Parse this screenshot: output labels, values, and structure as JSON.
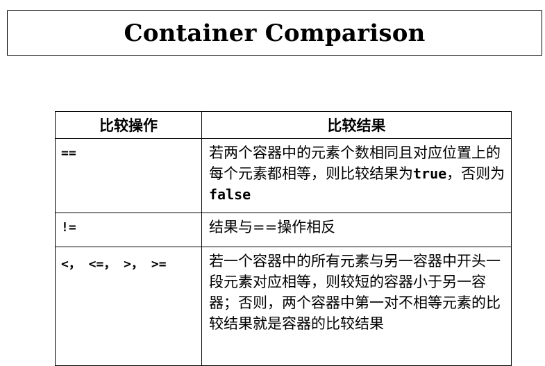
{
  "title": "Container Comparison",
  "table": {
    "headers": [
      "比较操作",
      "比较结果"
    ],
    "rows": [
      {
        "op": "==",
        "result_parts": [
          "若两个容器中的元素个数相同且对应位置上的每个元素都相等，则比较结果为",
          "true",
          "，否则为",
          "false"
        ]
      },
      {
        "op": "!=",
        "result_parts": [
          "结果与==操作相反"
        ]
      },
      {
        "op": "<， <=， >， >=",
        "result_parts": [
          "若一个容器中的所有元素与另一容器中开头一段元素对应相等，则较短的容器小于另一容器；否则，两个容器中第一对不相等元素的比较结果就是容器的比较结果"
        ]
      }
    ]
  }
}
